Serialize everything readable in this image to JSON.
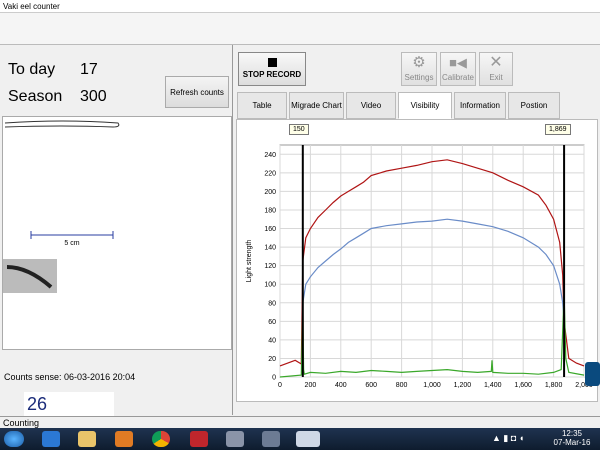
{
  "window": {
    "title": "Vaki eel counter"
  },
  "left": {
    "today_label": "To day",
    "today_value": "17",
    "season_label": "Season",
    "season_value": "300",
    "refresh_label": "Refresh counts",
    "scale_label": "5 cm",
    "counts_sense": "Counts sense: 06-03-2016 20:04",
    "count_value": "26"
  },
  "toolbar": {
    "stop_label": "STOP RECORD",
    "settings_label": "Settings",
    "calibrate_label": "Calibrate",
    "exit_label": "Exit"
  },
  "tabs": [
    {
      "label": "Table"
    },
    {
      "label": "Migrade Chart"
    },
    {
      "label": "Video"
    },
    {
      "label": "Visibility",
      "active": true
    },
    {
      "label": "Information"
    },
    {
      "label": "Postion"
    }
  ],
  "markers": {
    "left": "150",
    "right": "1,869"
  },
  "status": {
    "text": "Counting"
  },
  "taskbar": {
    "time": "12:35",
    "date": "07-Mar-16"
  },
  "chart_data": {
    "type": "line",
    "ylabel": "Light strength",
    "xlim": [
      0,
      2000
    ],
    "ylim": [
      0,
      250
    ],
    "x_ticks": [
      "0",
      "200",
      "400",
      "600",
      "800",
      "1,000",
      "1,200",
      "1,400",
      "1,600",
      "1,800",
      "2,000"
    ],
    "y_ticks": [
      "0",
      "20",
      "40",
      "60",
      "80",
      "100",
      "120",
      "140",
      "160",
      "180",
      "200",
      "220",
      "240"
    ],
    "vlines": [
      150,
      1869
    ],
    "series": [
      {
        "color": "#b01515",
        "x": [
          0,
          100,
          140,
          150,
          170,
          200,
          250,
          300,
          350,
          400,
          450,
          500,
          550,
          600,
          700,
          800,
          900,
          1000,
          1100,
          1200,
          1300,
          1400,
          1500,
          1600,
          1700,
          1750,
          1800,
          1840,
          1860,
          1869,
          1900,
          1950,
          2000
        ],
        "y": [
          12,
          18,
          14,
          125,
          150,
          160,
          172,
          180,
          188,
          195,
          200,
          205,
          210,
          217,
          222,
          225,
          228,
          232,
          234,
          230,
          225,
          220,
          212,
          205,
          196,
          185,
          170,
          145,
          110,
          60,
          20,
          15,
          12
        ]
      },
      {
        "color": "#6a8cc8",
        "x": [
          150,
          170,
          200,
          250,
          300,
          350,
          400,
          450,
          500,
          550,
          600,
          700,
          800,
          900,
          1000,
          1100,
          1200,
          1300,
          1400,
          1500,
          1600,
          1700,
          1750,
          1800,
          1840,
          1860,
          1869
        ],
        "y": [
          80,
          100,
          108,
          118,
          125,
          132,
          138,
          145,
          150,
          155,
          160,
          163,
          165,
          167,
          168,
          170,
          168,
          165,
          162,
          157,
          150,
          140,
          132,
          120,
          100,
          80,
          60
        ]
      },
      {
        "color": "#3aa82a",
        "x": [
          0,
          140,
          150,
          155,
          160,
          200,
          300,
          400,
          500,
          600,
          700,
          800,
          900,
          1000,
          1100,
          1200,
          1300,
          1390,
          1395,
          1400,
          1500,
          1600,
          1700,
          1800,
          1850,
          1869,
          1880,
          1900,
          2000
        ],
        "y": [
          0,
          2,
          75,
          8,
          3,
          5,
          4,
          6,
          5,
          7,
          6,
          5,
          6,
          7,
          8,
          6,
          5,
          6,
          18,
          5,
          4,
          4,
          3,
          5,
          8,
          90,
          20,
          5,
          2
        ]
      }
    ]
  }
}
